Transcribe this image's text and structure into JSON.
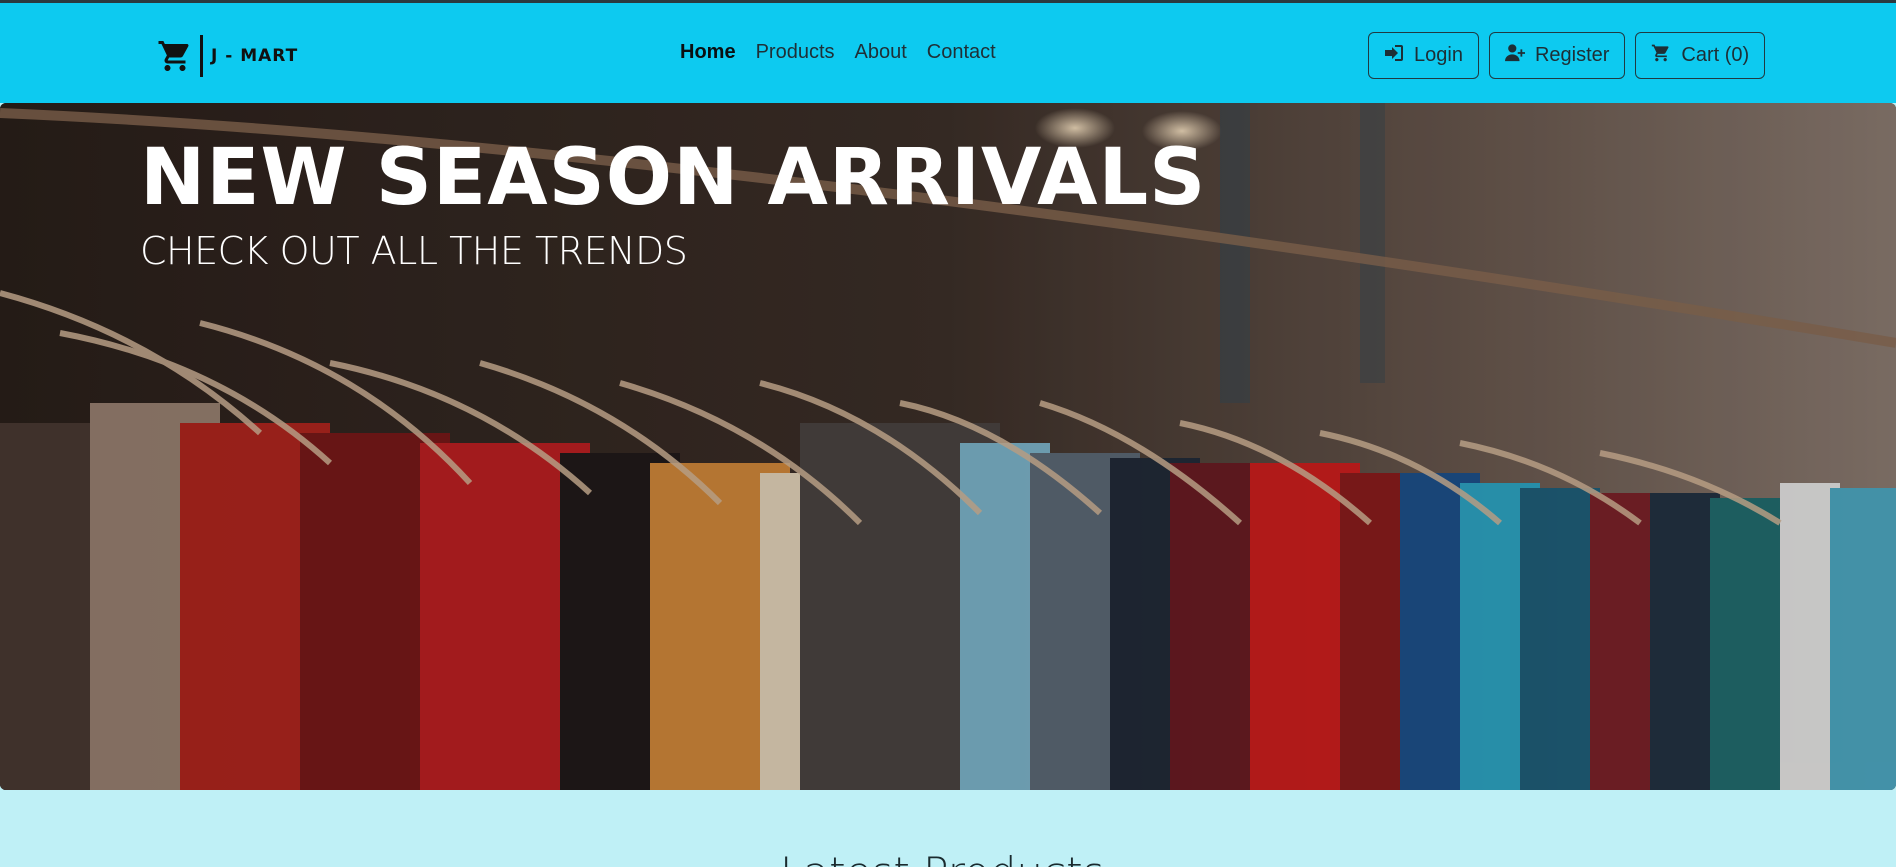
{
  "brand": {
    "name": "J - MART",
    "icon": "cart-icon"
  },
  "nav": {
    "links": [
      {
        "label": "Home",
        "active": true
      },
      {
        "label": "Products",
        "active": false
      },
      {
        "label": "About",
        "active": false
      },
      {
        "label": "Contact",
        "active": false
      }
    ],
    "buttons": [
      {
        "label": "Login",
        "icon": "sign-in-icon"
      },
      {
        "label": "Register",
        "icon": "user-plus-icon"
      },
      {
        "label": "Cart (0)",
        "icon": "cart-icon"
      }
    ]
  },
  "hero": {
    "title": "NEW SEASON ARRIVALS",
    "subtitle": "CHECK OUT ALL THE TRENDS"
  },
  "section": {
    "title": "Latest Products"
  },
  "colors": {
    "navbar": "#0dcaf0",
    "page_background": "#bff0f6"
  }
}
